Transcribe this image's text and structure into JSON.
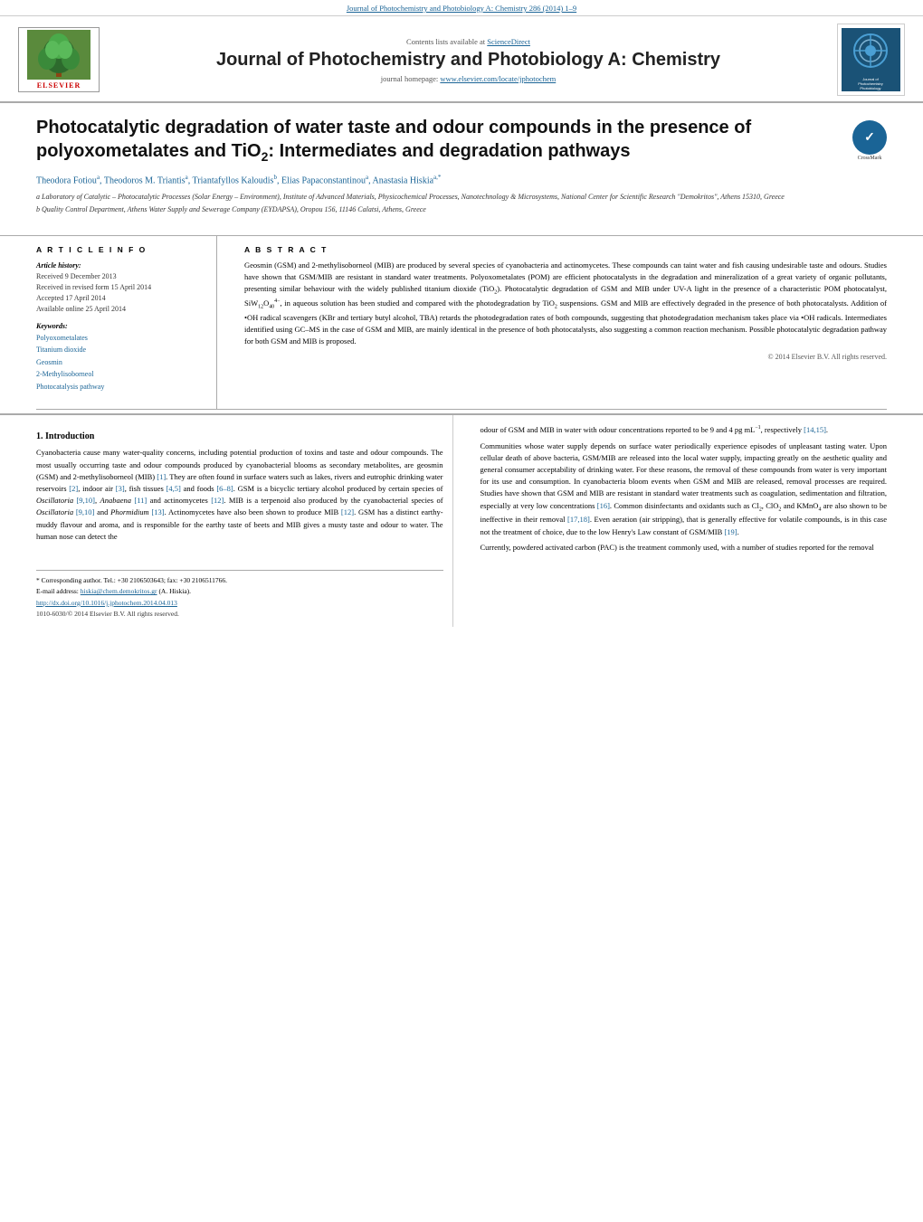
{
  "top_banner": {
    "journal_link": "Journal of Photochemistry and Photobiology A: Chemistry 286 (2014) 1–9"
  },
  "header": {
    "contents_label": "Contents lists available at",
    "sciencedirect": "ScienceDirect",
    "journal_title": "Journal of Photochemistry and Photobiology A: Chemistry",
    "homepage_label": "journal homepage:",
    "homepage_url": "www.elsevier.com/locate/jphotochem",
    "elsevier_label": "ELSEVIER",
    "logo_title": "Journal of Photochemistry & Photobiology"
  },
  "article": {
    "title": "Photocatalytic degradation of water taste and odour compounds in the presence of polyoxometalates and TiO₂: Intermediates and degradation pathways",
    "authors": "Theodora Fotiou a, Theodoros M. Triantis a, Triantafyllos Kaloudis b, Elias Papaconstantinou a, Anastasia Hiskia a,*",
    "affiliation_a": "a Laboratory of Catalytic – Photocatalytic Processes (Solar Energy – Environment), Institute of Advanced Materials, Physicochemical Processes, Nanotechnology & Microsystems, National Center for Scientific Research \"Demokritos\", Athens 15310, Greece",
    "affiliation_b": "b Quality Control Department, Athens Water Supply and Sewerage Company (EYDAPSA), Oropou 156, 11146 Calatsi, Athens, Greece"
  },
  "article_info": {
    "section_title": "A R T I C L E   I N F O",
    "history_label": "Article history:",
    "received": "Received 9 December 2013",
    "revised": "Received in revised form 15 April 2014",
    "accepted": "Accepted 17 April 2014",
    "available": "Available online 25 April 2014",
    "keywords_label": "Keywords:",
    "keywords": [
      "Polyoxometalates",
      "Titanium dioxide",
      "Geosmin",
      "2-Methylisoborneol",
      "Photocatalysis pathway"
    ]
  },
  "abstract": {
    "section_title": "A B S T R A C T",
    "text": "Geosmin (GSM) and 2-methylisoborneol (MIB) are produced by several species of cyanobacteria and actinomycetes. These compounds can taint water and fish causing undesirable taste and odours. Studies have shown that GSM/MIB are resistant in standard water treatments. Polyoxometalates (POM) are efficient photocatalysts in the degradation and mineralization of a great variety of organic pollutants, presenting similar behaviour with the widely published titanium dioxide (TiO₂). Photocatalytic degradation of GSM and MIB under UV-A light in the presence of a characteristic POM photocatalyst, SiW₁₂O₄₀⁴⁻, in aqueous solution has been studied and compared with the photodegradation by TiO₂ suspensions. GSM and MIB are effectively degraded in the presence of both photocatalysts. Addition of •OH radical scavengers (KBr and tertiary butyl alcohol, TBA) retards the photodegradation rates of both compounds, suggesting that photodegradation mechanism takes place via •OH radicals. Intermediates identified using GC–MS in the case of GSM and MIB, are mainly identical in the presence of both photocatalysts, also suggesting a common reaction mechanism. Possible photocatalytic degradation pathway for both GSM and MIB is proposed.",
    "copyright": "© 2014 Elsevier B.V. All rights reserved."
  },
  "introduction": {
    "heading": "1.  Introduction",
    "paragraph1": "Cyanobacteria cause many water-quality concerns, including potential production of toxins and taste and odour compounds. The most usually occurring taste and odour compounds produced by cyanobacterial blooms as secondary metabolites, are geosmin (GSM) and 2-methylisoborneol (MIB) [1]. They are often found in surface waters such as lakes, rivers and eutrophic drinking water reservoirs [2], indoor air [3], fish tissues [4,5] and foods [6–8]. GSM is a bicyclic tertiary alcohol produced by certain species of Oscillatoria [9,10], Anabaena [11] and actinomycetes [12]. MIB is a terpenoid also produced by the cyanobacterial species of Oscillatoria [9,10] and Phormidium [13]. Actinomycetes have also been shown to produce MIB [12]. GSM has a distinct earthy-muddy flavour and aroma, and is responsible for the earthy taste of beets and MIB gives a musty taste and odour to water. The human nose can detect the",
    "paragraph2_right": "odour of GSM and MIB in water with odour concentrations reported to be 9 and 4 pg mL⁻¹, respectively [14,15].",
    "paragraph3_right": "Communities whose water supply depends on surface water periodically experience episodes of unpleasant tasting water. Upon cellular death of above bacteria, GSM/MIB are released into the local water supply, impacting greatly on the aesthetic quality and general consumer acceptability of drinking water. For these reasons, the removal of these compounds from water is very important for its use and consumption. In cyanobacteria bloom events when GSM and MIB are released, removal processes are required. Studies have shown that GSM and MIB are resistant in standard water treatments such as coagulation, sedimentation and filtration, especially at very low concentrations [16]. Common disinfectants and oxidants such as Cl₂, ClO₂ and KMnO₄ are also shown to be ineffective in their removal [17,18]. Even aeration (air stripping), that is generally effective for volatile compounds, is in this case not the treatment of choice, due to the low Henry's Law constant of GSM/MIB [19].",
    "paragraph4_right": "Currently, powdered activated carbon (PAC) is the treatment commonly used, with a number of studies reported for the removal"
  },
  "footer": {
    "footnote_star": "* Corresponding author. Tel.: +30 2106503643; fax: +30 2106511766.",
    "email_label": "E-mail address:",
    "email": "hiskia@chem.demokritos.gr",
    "email_suffix": "(A. Hiskia).",
    "doi": "http://dx.doi.org/10.1016/j.jphotochem.2014.04.013",
    "issn": "1010-6030/© 2014 Elsevier B.V. All rights reserved."
  }
}
